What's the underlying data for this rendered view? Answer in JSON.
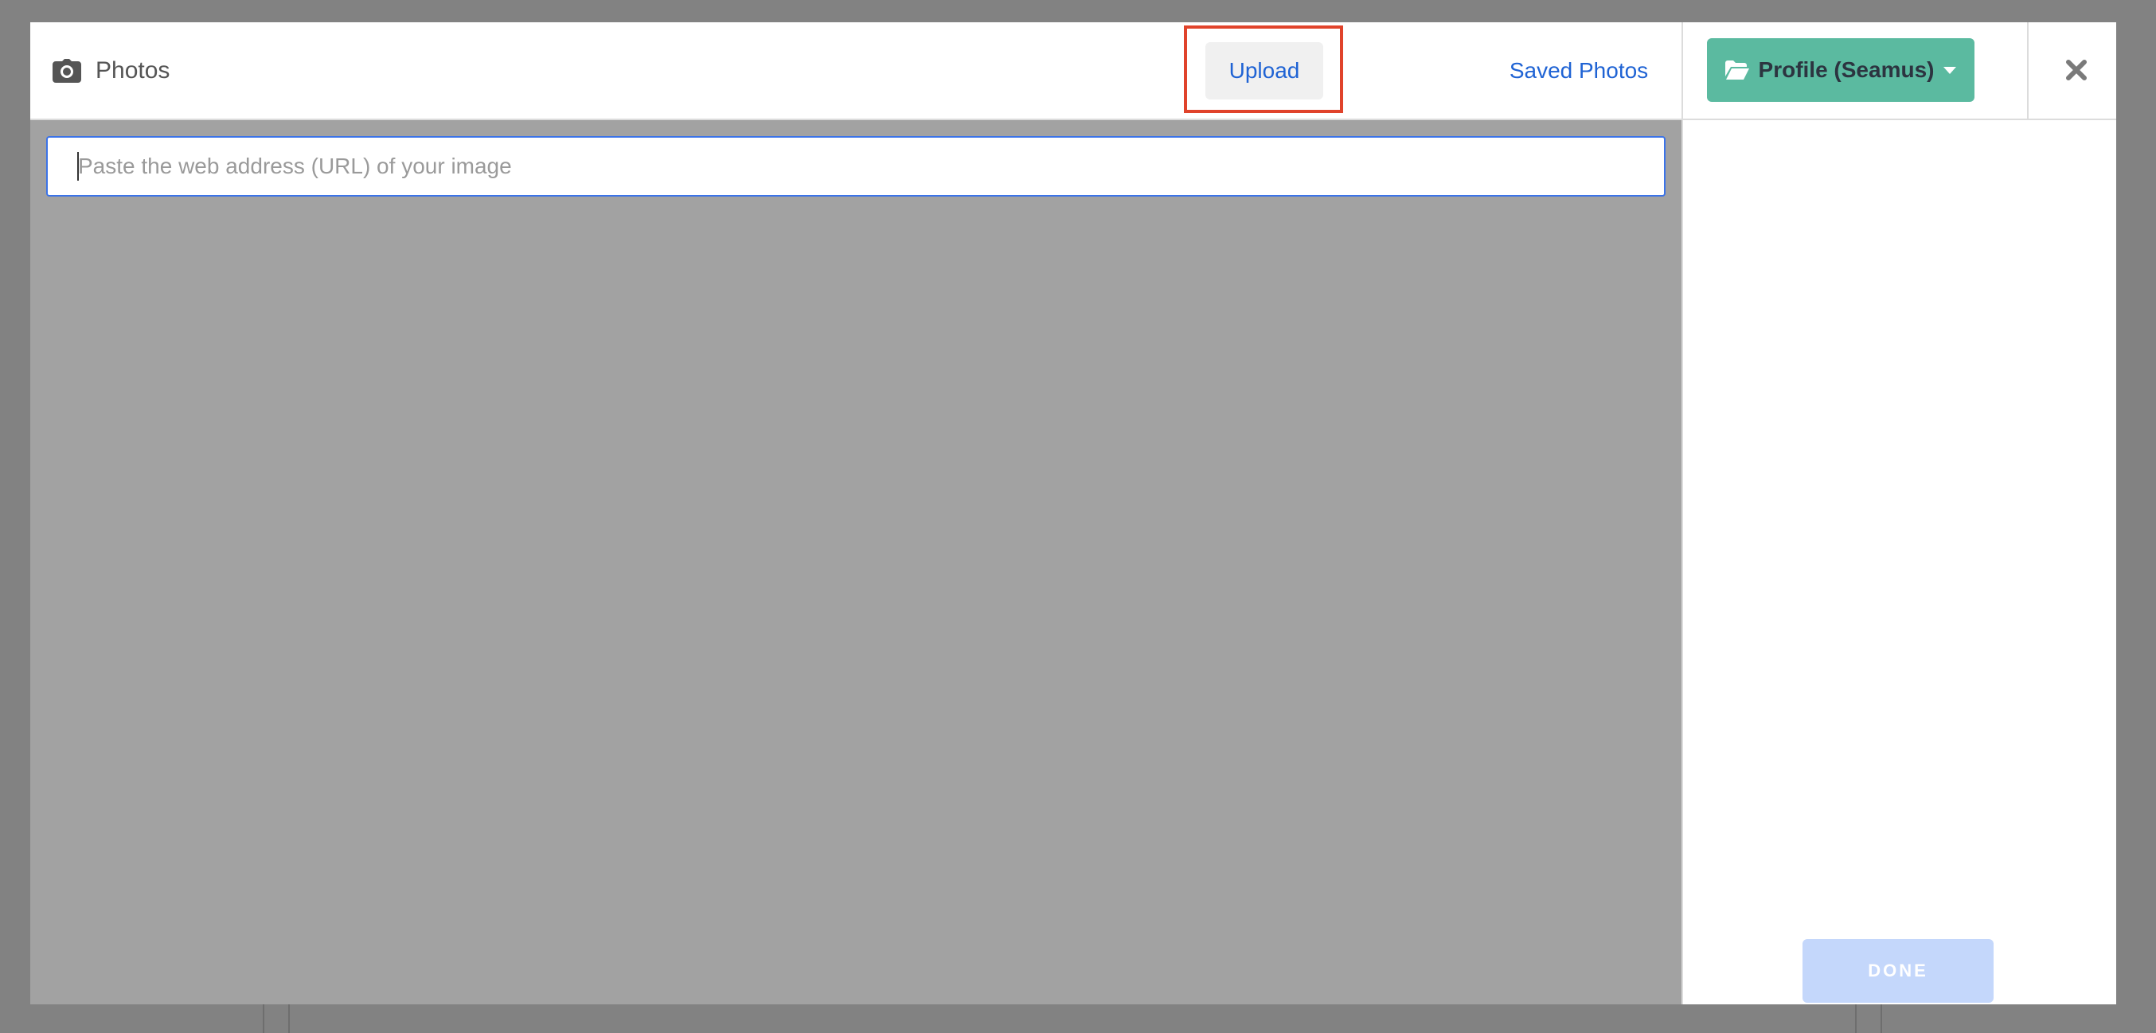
{
  "modal": {
    "title": "Photos",
    "title_icon": "camera-icon"
  },
  "tabs": [
    {
      "label": "Upload",
      "active": true
    },
    {
      "label": "Saved Photos",
      "active": false
    }
  ],
  "profile_dropdown": {
    "label": "Profile (Seamus)",
    "icon": "folder-open-icon",
    "color": "#5bbaa0"
  },
  "close": {
    "icon": "close-icon"
  },
  "url_input": {
    "placeholder": "Paste the web address (URL) of your image",
    "value": ""
  },
  "done_button": {
    "label": "DONE",
    "disabled": true
  },
  "colors": {
    "accent_link": "#1f63d4",
    "highlight": "#e0432b",
    "input_border": "#3b73e8"
  }
}
